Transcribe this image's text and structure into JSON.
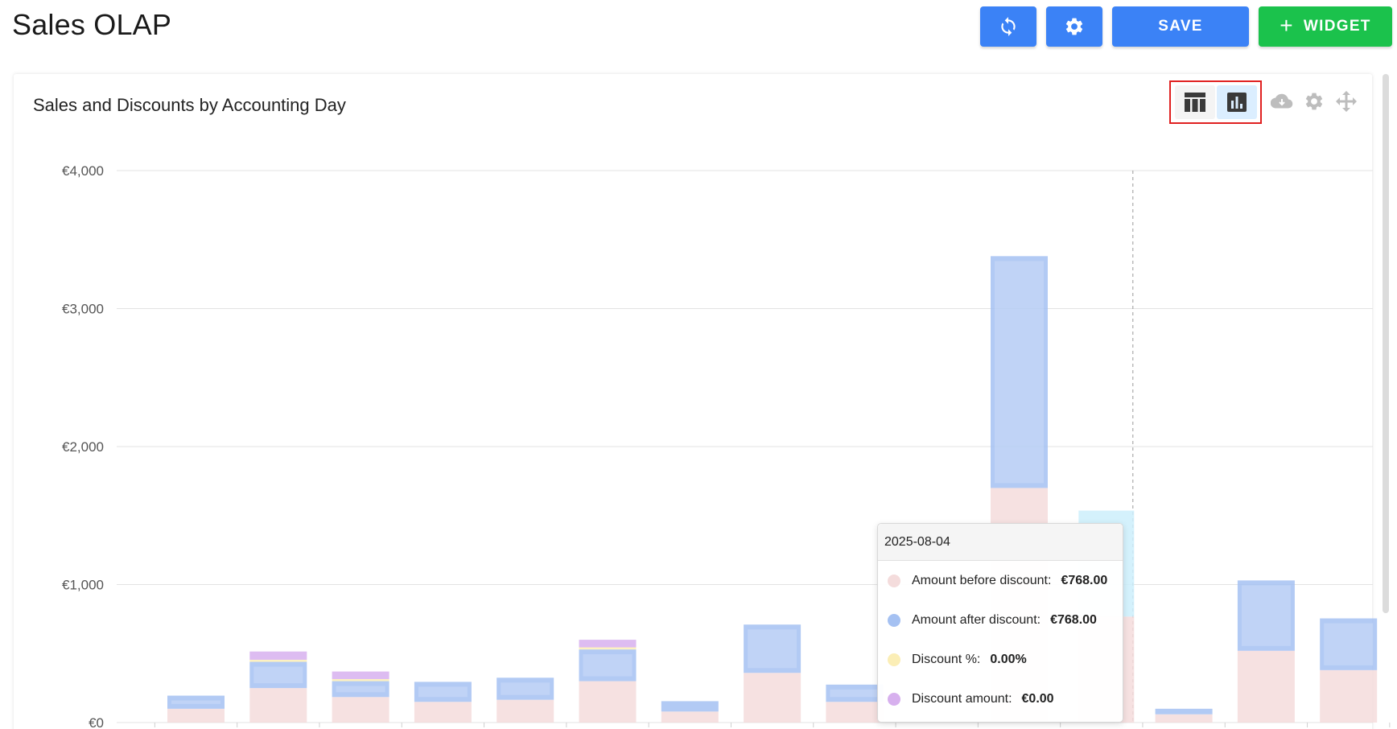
{
  "page": {
    "title": "Sales OLAP"
  },
  "toolbar": {
    "refresh_icon": "refresh-icon",
    "settings_icon": "gear-icon",
    "save_label": "SAVE",
    "widget_plus": "+",
    "widget_label": "WIDGET"
  },
  "widget": {
    "title": "Sales and Discounts by Accounting Day",
    "icons": [
      "table-icon",
      "bar-chart-icon",
      "cloud-download-icon",
      "gear-icon",
      "move-icon"
    ]
  },
  "colors": {
    "primary": "#3b82f6",
    "success": "#1bc24c",
    "toggle_outline": "#e02020",
    "amount_before": "#f4dcdc",
    "amount_after": "#a5c1f2",
    "discount_pct": "#fbeeb6",
    "discount_amount": "#d7b0ee",
    "hover_bar": "#cdeefb"
  },
  "chart_data": {
    "type": "bar",
    "stacked": true,
    "x_tick_labels_visible": false,
    "ylim": [
      0,
      4000
    ],
    "y_ticks": [
      0,
      1000,
      2000,
      3000,
      4000
    ],
    "y_tick_labels": [
      "€0",
      "€1,000",
      "€2,000",
      "€3,000",
      "€4,000"
    ],
    "grid": true,
    "hover_index": 11,
    "series": [
      {
        "name": "Amount before discount",
        "color": "#f4dcdc",
        "values": [
          100,
          250,
          185,
          150,
          165,
          300,
          80,
          360,
          150,
          0,
          1700,
          768,
          60,
          520,
          380
        ]
      },
      {
        "name": "Amount after discount",
        "color": "#a5c1f2",
        "values": [
          95,
          190,
          115,
          145,
          160,
          230,
          75,
          350,
          125,
          0,
          1680,
          768,
          40,
          510,
          375
        ]
      },
      {
        "name": "Discount %",
        "color": "#fbeeb6",
        "values": [
          0,
          15,
          15,
          0,
          0,
          15,
          0,
          0,
          0,
          0,
          0,
          0,
          0,
          0,
          0
        ]
      },
      {
        "name": "Discount amount",
        "color": "#d7b0ee",
        "values": [
          0,
          60,
          55,
          0,
          0,
          55,
          0,
          0,
          0,
          0,
          0,
          0,
          0,
          0,
          0
        ]
      }
    ]
  },
  "tooltip": {
    "date": "2025-08-04",
    "rows": [
      {
        "label": "Amount before discount:",
        "value": "€768.00",
        "color": "#f4dcdc"
      },
      {
        "label": "Amount after discount:",
        "value": "€768.00",
        "color": "#a5c1f2"
      },
      {
        "label": "Discount %:",
        "value": "0.00%",
        "color": "#fbeeb6"
      },
      {
        "label": "Discount amount:",
        "value": "€0.00",
        "color": "#d7b0ee"
      }
    ]
  }
}
